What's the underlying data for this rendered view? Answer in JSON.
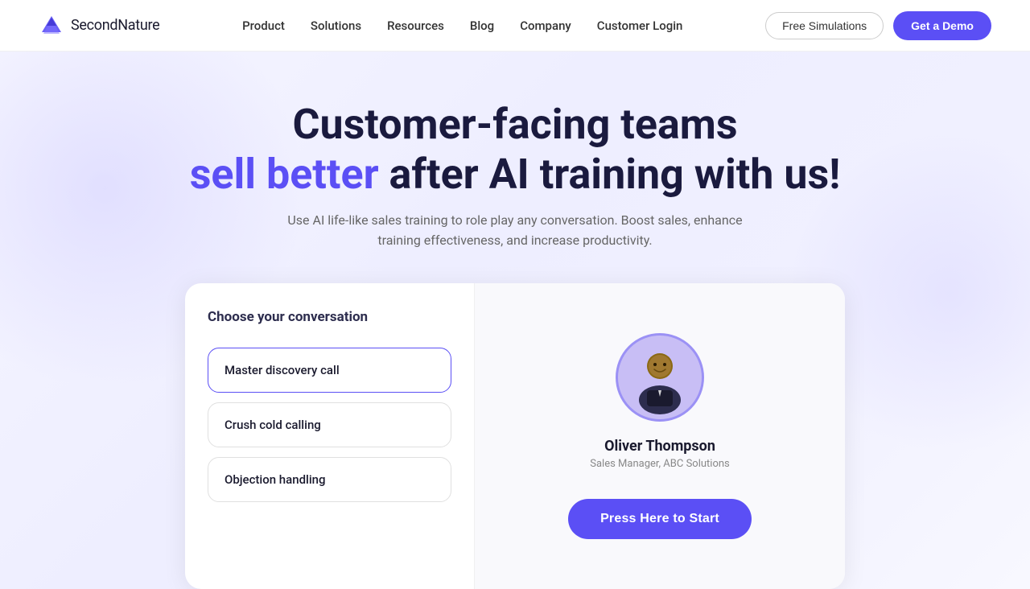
{
  "nav": {
    "logo_bold": "Second",
    "logo_light": "Nature",
    "links": [
      {
        "label": "Product",
        "id": "product"
      },
      {
        "label": "Solutions",
        "id": "solutions"
      },
      {
        "label": "Resources",
        "id": "resources"
      },
      {
        "label": "Blog",
        "id": "blog"
      },
      {
        "label": "Company",
        "id": "company"
      },
      {
        "label": "Customer Login",
        "id": "customer-login"
      }
    ],
    "free_simulations": "Free Simulations",
    "get_demo": "Get a Demo"
  },
  "hero": {
    "title_line1": "Customer-facing teams",
    "title_highlight": "sell better",
    "title_line2": " after AI training with us!",
    "subtitle": "Use AI life-like sales training to role play any conversation. Boost sales, enhance training effectiveness, and increase productivity."
  },
  "card": {
    "section_title": "Choose your conversation",
    "conversations": [
      {
        "label": "Master discovery call",
        "id": "discovery",
        "active": true
      },
      {
        "label": "Crush cold calling",
        "id": "cold-calling",
        "active": false
      },
      {
        "label": "Objection handling",
        "id": "objection",
        "active": false
      }
    ],
    "agent": {
      "name": "Oliver Thompson",
      "role": "Sales Manager, ABC Solutions"
    },
    "start_button": "Press Here to Start"
  }
}
